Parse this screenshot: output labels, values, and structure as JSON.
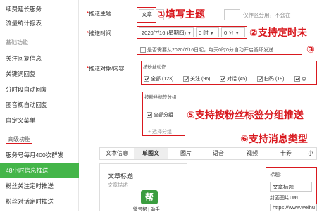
{
  "sidebar": {
    "items": [
      {
        "label": "续费延长服务",
        "type": "item"
      },
      {
        "label": "流量统计报表",
        "type": "item"
      },
      {
        "label": "基础功能",
        "type": "group"
      },
      {
        "label": "关注回复信息",
        "type": "item"
      },
      {
        "label": "关键词回复",
        "type": "item"
      },
      {
        "label": "分时段自动回复",
        "type": "item"
      },
      {
        "label": "图音视自动回复",
        "type": "item"
      },
      {
        "label": "自定义菜单",
        "type": "item"
      },
      {
        "label": "高级功能",
        "type": "group-boxed"
      },
      {
        "label": "服务号每月400次群发",
        "type": "item"
      },
      {
        "label": "48小时信息推送",
        "type": "active"
      },
      {
        "label": "粉丝关注定时推送",
        "type": "item"
      },
      {
        "label": "粉丝对话定时推送",
        "type": "item"
      }
    ]
  },
  "form": {
    "theme_label": "推送主题",
    "theme_value": "文章",
    "theme_hint": "仅作区分用，不会在",
    "time_label": "推送时间",
    "date_value": "2020/7/16 (星期四)",
    "hour_value": "0 时",
    "minute_value": "0 分",
    "repeat_text": "是否需要从2020/7/16日起，每天0时0分自动开启循环发送",
    "audience_label": "推送对象/内容",
    "by_action_title": "按粉丝动作",
    "actions": [
      {
        "label": "全部",
        "count": "(123)",
        "checked": true
      },
      {
        "label": "关注",
        "count": "(96)",
        "checked": true
      },
      {
        "label": "对话",
        "count": "(45)",
        "checked": true
      },
      {
        "label": "扫码",
        "count": "(19)",
        "checked": true
      },
      {
        "label": "点",
        "count": "",
        "checked": true
      }
    ],
    "by_tag_title": "按粉丝标签分组",
    "tag_all": "全部分组",
    "tag_add": "+ 选择分组"
  },
  "annotations": {
    "a1": "①填写主题",
    "a2": "②支持定时未",
    "a3": "③",
    "a5": "⑤支持按粉丝标签分组推送",
    "a6": "⑥支持消息类型"
  },
  "tabs": [
    "文本信息",
    "单图文",
    "图片",
    "语音",
    "视频",
    "卡券",
    "小"
  ],
  "tabs_active": "单图文",
  "article": {
    "title": "文章标题",
    "desc": "文章描述",
    "logo_char": "帮",
    "logo_text": "微号帮 | 助手"
  },
  "edit_panel": {
    "title_label": "标题:",
    "title_value": "文章标题",
    "cover_label": "封面图片URL:",
    "cover_value": "https://www.weihu"
  },
  "colors": {
    "accent_green": "#44b549",
    "annotation_red": "#d9191f"
  }
}
